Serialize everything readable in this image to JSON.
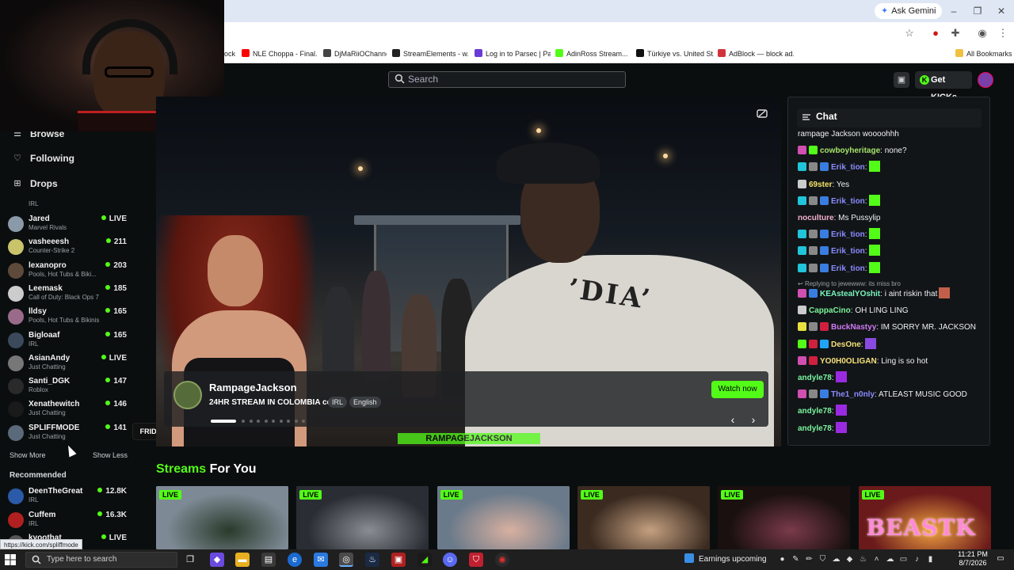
{
  "browser": {
    "ask_gemini": "Ask Gemini",
    "bookmarks": [
      {
        "label": "ock",
        "color": "#888888"
      },
      {
        "label": "NLE Choppa - Final...",
        "color": "#ff0000"
      },
      {
        "label": "DjMaRiiOChannel",
        "color": "#444444"
      },
      {
        "label": "StreamElements - w...",
        "color": "#222222"
      },
      {
        "label": "Log in to Parsec | Pa...",
        "color": "#6a3ad8"
      },
      {
        "label": "AdinRoss Stream...",
        "color": "#53fc18"
      },
      {
        "label": "Türkiye vs. United St...",
        "color": "#111111"
      },
      {
        "label": "AdBlock — block ad...",
        "color": "#d0343a"
      }
    ],
    "all_bookmarks": "All Bookmarks",
    "status_url": "https://kick.com/spliffmode"
  },
  "header": {
    "search_placeholder": "Search",
    "get_kicks": "Get KICKs"
  },
  "sidebar": {
    "nav": [
      {
        "label": "Browse",
        "icon": "compass-icon"
      },
      {
        "label": "Following",
        "icon": "heart-icon"
      },
      {
        "label": "Drops",
        "icon": "gift-icon"
      }
    ],
    "following": [
      {
        "name": "Jared",
        "category": "Marvel Rivals",
        "count": "LIVE",
        "color": "#8a9aa8"
      },
      {
        "name": "vasheeesh",
        "category": "Counter-Strike 2",
        "count": "211",
        "color": "#c9c36a"
      },
      {
        "name": "lexanopro",
        "category": "Pools, Hot Tubs & Biki...",
        "count": "203",
        "color": "#5e4a3a"
      },
      {
        "name": "Leemask",
        "category": "Call of Duty: Black Ops 7",
        "count": "185",
        "color": "#cccccc"
      },
      {
        "name": "lldsy",
        "category": "Pools, Hot Tubs & Bikinis",
        "count": "165",
        "color": "#9a6a8a"
      },
      {
        "name": "Bigloaaf",
        "category": "IRL",
        "count": "165",
        "color": "#3a4a5a"
      },
      {
        "name": "AsianAndy",
        "category": "Just Chatting",
        "count": "LIVE",
        "color": "#777777"
      },
      {
        "name": "Santi_DGK",
        "category": "Roblox",
        "count": "147",
        "color": "#2a2a2a"
      },
      {
        "name": "Xenathewitch",
        "category": "Just Chatting",
        "count": "146",
        "color": "#1a1a1a"
      },
      {
        "name": "SPLIFFMODE",
        "category": "Just Chatting",
        "count": "141",
        "color": "#5a6a7a"
      }
    ],
    "show_more": "Show More",
    "show_less": "Show Less",
    "recommended_heading": "Recommended",
    "recommended": [
      {
        "name": "DeenTheGreat",
        "category": "IRL",
        "count": "12.8K",
        "color": "#2a5aa8"
      },
      {
        "name": "Cuffem",
        "category": "IRL",
        "count": "16.3K",
        "color": "#b02020"
      },
      {
        "name": "kyoothat",
        "category": "",
        "count": "LIVE",
        "color": "#555555"
      }
    ],
    "tooltip": "FRIDAYS WITH HOUSEPHONE!!"
  },
  "featured": {
    "name": "RampageJackson",
    "title": "24HR STREAM IN COLOMBIA co",
    "tags": [
      "IRL",
      "English"
    ],
    "watch_now": "Watch now",
    "banner": "RAMPAGEJACKSON",
    "shirt_print": "’DIA’"
  },
  "chat": {
    "title": "Chat",
    "messages": [
      {
        "type": "text",
        "user": "",
        "text": "rampage Jackson woooohhh",
        "badges": [],
        "emote": "",
        "user_color": "#ffffff"
      },
      {
        "type": "msg",
        "user": "cowboyheritage",
        "text": ": none?",
        "badges": [
          "#d04fb0",
          "#53fc18"
        ],
        "emote": "",
        "user_color": "#a6e36b"
      },
      {
        "type": "msg",
        "user": "Erik_tion",
        "text": ":",
        "badges": [
          "#21c4d8",
          "#888888",
          "#3a7de0"
        ],
        "emote": "#53fc18",
        "user_color": "#8a8cff"
      },
      {
        "type": "msg",
        "user": "69ster",
        "text": ": Yes",
        "badges": [
          "#cccccc"
        ],
        "emote": "",
        "user_color": "#f2e36b"
      },
      {
        "type": "msg",
        "user": "Erik_tion",
        "text": ":",
        "badges": [
          "#21c4d8",
          "#888888",
          "#3a7de0"
        ],
        "emote": "#53fc18",
        "user_color": "#8a8cff"
      },
      {
        "type": "msg",
        "user": "noculture",
        "text": ": Ms Pussylip",
        "badges": [],
        "emote": "",
        "user_color": "#f2b0d0"
      },
      {
        "type": "msg",
        "user": "Erik_tion",
        "text": ":",
        "badges": [
          "#21c4d8",
          "#888888",
          "#3a7de0"
        ],
        "emote": "#53fc18",
        "user_color": "#8a8cff"
      },
      {
        "type": "msg",
        "user": "Erik_tion",
        "text": ":",
        "badges": [
          "#21c4d8",
          "#888888",
          "#3a7de0"
        ],
        "emote": "#53fc18",
        "user_color": "#8a8cff"
      },
      {
        "type": "msg",
        "user": "Erik_tion",
        "text": ":",
        "badges": [
          "#21c4d8",
          "#888888",
          "#3a7de0"
        ],
        "emote": "#53fc18",
        "user_color": "#8a8cff"
      }
    ],
    "reply_note": "Replying to jewewww: its miss bro",
    "messages2": [
      {
        "type": "msg",
        "user": "KEAstealYOshit",
        "text": ": i aint riskin that",
        "badges": [
          "#d04fb0",
          "#3a7de0"
        ],
        "emote": "#c0604a",
        "user_color": "#7af5c0"
      },
      {
        "type": "msg",
        "user": "CappaCino",
        "text": ": OH LING LING",
        "badges": [
          "#cccccc"
        ],
        "emote": "",
        "user_color": "#7af59a"
      },
      {
        "type": "msg",
        "user": "BuckNastyy",
        "text": ": IM SORRY MR. JACKSON",
        "badges": [
          "#e8e040",
          "#888888",
          "#d02040"
        ],
        "emote": "",
        "user_color": "#d07af5"
      },
      {
        "type": "msg",
        "user": "DesOne",
        "text": ":",
        "badges": [
          "#53fc18",
          "#d02040",
          "#21a4f8"
        ],
        "emote": "#8a4ae0",
        "user_color": "#f5e07a"
      },
      {
        "type": "msg",
        "user": "YO0H0OLIGAN",
        "text": ": Ling is so hot",
        "badges": [
          "#d04fb0",
          "#d02040"
        ],
        "emote": "",
        "user_color": "#f5e07a"
      },
      {
        "type": "msg",
        "user": "andyle78",
        "text": ":",
        "badges": [],
        "emote": "#9a2ae0",
        "user_color": "#7af5a0"
      },
      {
        "type": "msg",
        "user": "The1_n0nly",
        "text": ": ATLEAST MUSIC GOOD",
        "badges": [
          "#d04fb0",
          "#888888",
          "#3a7de0"
        ],
        "emote": "",
        "user_color": "#8a8cff"
      },
      {
        "type": "msg",
        "user": "andyle78",
        "text": ":",
        "badges": [],
        "emote": "#9a2ae0",
        "user_color": "#7af5a0"
      },
      {
        "type": "msg",
        "user": "andyle78",
        "text": ":",
        "badges": [],
        "emote": "#9a2ae0",
        "user_color": "#7af5a0"
      }
    ]
  },
  "streams": {
    "heading_accent": "Streams",
    "heading_rest": " For You",
    "live_label": "LIVE",
    "thumbs": [
      {
        "bg": "#7d8a95",
        "accent": "#2a3a2a"
      },
      {
        "bg": "#2a2e34",
        "accent": "#8a8e94"
      },
      {
        "bg": "#6a7a8a",
        "accent": "#d8b0a0"
      },
      {
        "bg": "#3a2a20",
        "accent": "#c4a080"
      },
      {
        "bg": "#1a1010",
        "accent": "#7a3a4a"
      },
      {
        "bg": "#6a1a1a",
        "accent": "#f0a040"
      }
    ],
    "thumb_overlay_text": "BEASTK"
  },
  "taskbar": {
    "search_placeholder": "Type here to search",
    "news": "Earnings upcoming",
    "time": "11:21 PM",
    "date": "8/7/2026"
  }
}
